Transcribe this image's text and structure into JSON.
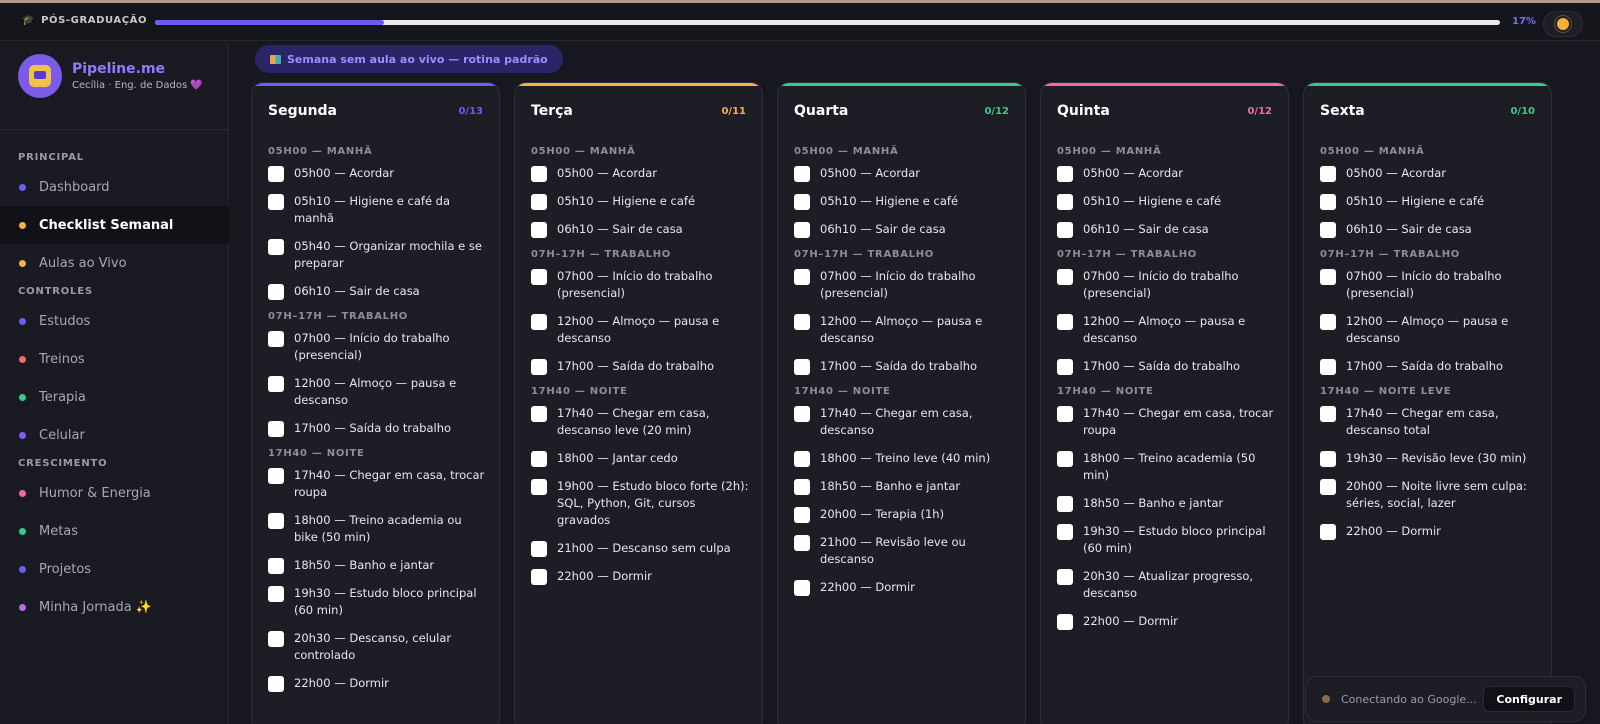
{
  "topbar": {
    "title": "PÓS-GRADUAÇÃO",
    "title_icon": "graduation-cap-icon",
    "progress": 0.17,
    "progress_label": "17%",
    "theme_icon": "sun-icon",
    "progress_color": "#6b5cf0"
  },
  "profile": {
    "name": "Pipeline.me",
    "subtitle": "Cecília · Eng. de Dados",
    "heart": "💜"
  },
  "nav": {
    "sections": [
      {
        "title": "PRINCIPAL",
        "items": [
          {
            "label": "Dashboard",
            "color": "#6f5cf5",
            "active": false
          },
          {
            "label": "Checklist Semanal",
            "color": "#f5b24a",
            "active": true
          },
          {
            "label": "Aulas ao Vivo",
            "color": "#f5b24a",
            "active": false
          }
        ]
      },
      {
        "title": "CONTROLES",
        "items": [
          {
            "label": "Estudos",
            "color": "#6f5cf5",
            "active": false
          },
          {
            "label": "Treinos",
            "color": "#f26b6b",
            "active": false
          },
          {
            "label": "Terapia",
            "color": "#3ac98a",
            "active": false
          },
          {
            "label": "Celular",
            "color": "#8a5cf5",
            "active": false
          }
        ]
      },
      {
        "title": "CRESCIMENTO",
        "items": [
          {
            "label": "Humor & Energia",
            "color": "#f26ba0",
            "active": false
          },
          {
            "label": "Metas",
            "color": "#3ac98a",
            "active": false
          },
          {
            "label": "Projetos",
            "color": "#6f5cf5",
            "active": false
          },
          {
            "label": "Minha Jornada ✨",
            "color": "#b06cf5",
            "active": false
          }
        ]
      }
    ]
  },
  "banner": {
    "text": "Semana sem aula ao vivo — rotina padrão",
    "icon": "books-icon"
  },
  "days": [
    {
      "name": "Segunda",
      "count": "0/13",
      "color": "#6f5cf5",
      "sections": [
        {
          "title": "05H00 — MANHÃ",
          "tasks": [
            "05h00 — Acordar",
            "05h10 — Higiene e café da manhã",
            "05h40 — Organizar mochila e se preparar",
            "06h10 — Sair de casa"
          ]
        },
        {
          "title": "07H–17H — TRABALHO",
          "tasks": [
            "07h00 — Início do trabalho (presencial)",
            "12h00 — Almoço — pausa e descanso",
            "17h00 — Saída do trabalho"
          ]
        },
        {
          "title": "17H40 — NOITE",
          "tasks": [
            "17h40 — Chegar em casa, trocar roupa",
            "18h00 — Treino academia ou bike (50 min)",
            "18h50 — Banho e jantar",
            "19h30 — Estudo bloco principal (60 min)",
            "20h30 — Descanso, celular controlado",
            "22h00 — Dormir"
          ]
        }
      ]
    },
    {
      "name": "Terça",
      "count": "0/11",
      "color": "#f5b24a",
      "sections": [
        {
          "title": "05H00 — MANHÃ",
          "tasks": [
            "05h00 — Acordar",
            "05h10 — Higiene e café",
            "06h10 — Sair de casa"
          ]
        },
        {
          "title": "07H–17H — TRABALHO",
          "tasks": [
            "07h00 — Início do trabalho (presencial)",
            "12h00 — Almoço — pausa e descanso",
            "17h00 — Saída do trabalho"
          ]
        },
        {
          "title": "17H40 — NOITE",
          "tasks": [
            "17h40 — Chegar em casa, descanso leve (20 min)",
            "18h00 — Jantar cedo",
            "19h00 — Estudo bloco forte (2h): SQL, Python, Git, cursos gravados",
            "21h00 — Descanso sem culpa",
            "22h00 — Dormir"
          ]
        }
      ]
    },
    {
      "name": "Quarta",
      "count": "0/12",
      "color": "#3ac98a",
      "sections": [
        {
          "title": "05H00 — MANHÃ",
          "tasks": [
            "05h00 — Acordar",
            "05h10 — Higiene e café",
            "06h10 — Sair de casa"
          ]
        },
        {
          "title": "07H–17H — TRABALHO",
          "tasks": [
            "07h00 — Início do trabalho (presencial)",
            "12h00 — Almoço — pausa e descanso",
            "17h00 — Saída do trabalho"
          ]
        },
        {
          "title": "17H40 — NOITE",
          "tasks": [
            "17h40 — Chegar em casa, descanso",
            "18h00 — Treino leve (40 min)",
            "18h50 — Banho e jantar",
            "20h00 — Terapia (1h)",
            "21h00 — Revisão leve ou descanso",
            "22h00 — Dormir"
          ]
        }
      ]
    },
    {
      "name": "Quinta",
      "count": "0/12",
      "color": "#f26ba0",
      "sections": [
        {
          "title": "05H00 — MANHÃ",
          "tasks": [
            "05h00 — Acordar",
            "05h10 — Higiene e café",
            "06h10 — Sair de casa"
          ]
        },
        {
          "title": "07H–17H — TRABALHO",
          "tasks": [
            "07h00 — Início do trabalho (presencial)",
            "12h00 — Almoço — pausa e descanso",
            "17h00 — Saída do trabalho"
          ]
        },
        {
          "title": "17H40 — NOITE",
          "tasks": [
            "17h40 — Chegar em casa, trocar roupa",
            "18h00 — Treino academia (50 min)",
            "18h50 — Banho e jantar",
            "19h30 — Estudo bloco principal (60 min)",
            "20h30 — Atualizar progresso, descanso",
            "22h00 — Dormir"
          ]
        }
      ]
    },
    {
      "name": "Sexta",
      "count": "0/10",
      "color": "#3ac98a",
      "sections": [
        {
          "title": "05H00 — MANHÃ",
          "tasks": [
            "05h00 — Acordar",
            "05h10 — Higiene e café",
            "06h10 — Sair de casa"
          ]
        },
        {
          "title": "07H–17H — TRABALHO",
          "tasks": [
            "07h00 — Início do trabalho (presencial)",
            "12h00 — Almoço — pausa e descanso",
            "17h00 — Saída do trabalho"
          ]
        },
        {
          "title": "17H40 — NOITE LEVE",
          "tasks": [
            "17h40 — Chegar em casa, descanso total",
            "19h30 — Revisão leve (30 min)",
            "20h00 — Noite livre sem culpa: séries, social, lazer",
            "22h00 — Dormir"
          ]
        }
      ]
    }
  ],
  "connection": {
    "status": "Conectando ao Google...",
    "button": "Configurar"
  }
}
